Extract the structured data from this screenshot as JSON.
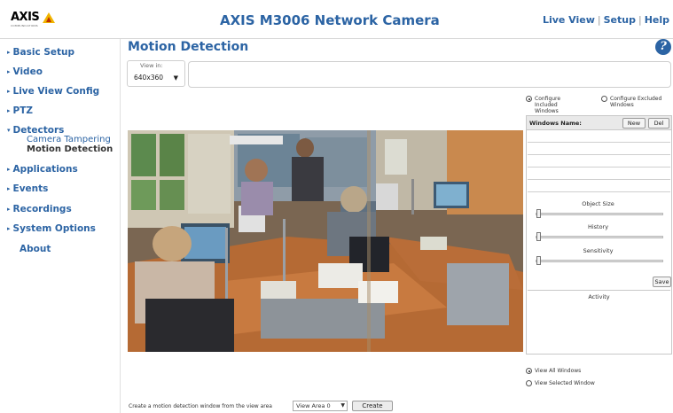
{
  "brand": {
    "logo_text": "AXIS",
    "logo_sub": "COMMUNICATIONS",
    "accent_color": "#2c64a4"
  },
  "header": {
    "title": "AXIS M3006 Network Camera",
    "links": [
      "Live View",
      "Setup",
      "Help"
    ]
  },
  "sidebar": {
    "items": [
      {
        "label": "Basic Setup",
        "arrow": "▸"
      },
      {
        "label": "Video",
        "arrow": "▸"
      },
      {
        "label": "Live View Config",
        "arrow": "▸"
      },
      {
        "label": "PTZ",
        "arrow": "▸"
      },
      {
        "label": "Detectors",
        "arrow": "▾"
      },
      {
        "label": "Applications",
        "arrow": "▸"
      },
      {
        "label": "Events",
        "arrow": "▸"
      },
      {
        "label": "Recordings",
        "arrow": "▸"
      },
      {
        "label": "System Options",
        "arrow": "▸"
      },
      {
        "label": "About",
        "arrow": ""
      }
    ],
    "sub_items": [
      {
        "label": "Camera Tampering"
      },
      {
        "label": "Motion Detection"
      }
    ]
  },
  "main": {
    "title": "Motion Detection",
    "help_glyph": "?",
    "view_in": {
      "label": "View in:",
      "value": "640x360"
    },
    "configure": {
      "included": "Configure Included Windows",
      "excluded": "Configure Excluded Windows"
    },
    "windows": {
      "label": "Windows Name:",
      "new_label": "New",
      "del_label": "Del"
    },
    "sliders": {
      "object_size": "Object Size",
      "history": "History",
      "sensitivity": "Sensitivity"
    },
    "save_label": "Save",
    "activity_label": "Activity",
    "view_all": "View All Windows",
    "view_selected": "View Selected Window",
    "create": {
      "text": "Create a motion detection window from the view area",
      "area": "View Area 0",
      "button": "Create"
    }
  }
}
